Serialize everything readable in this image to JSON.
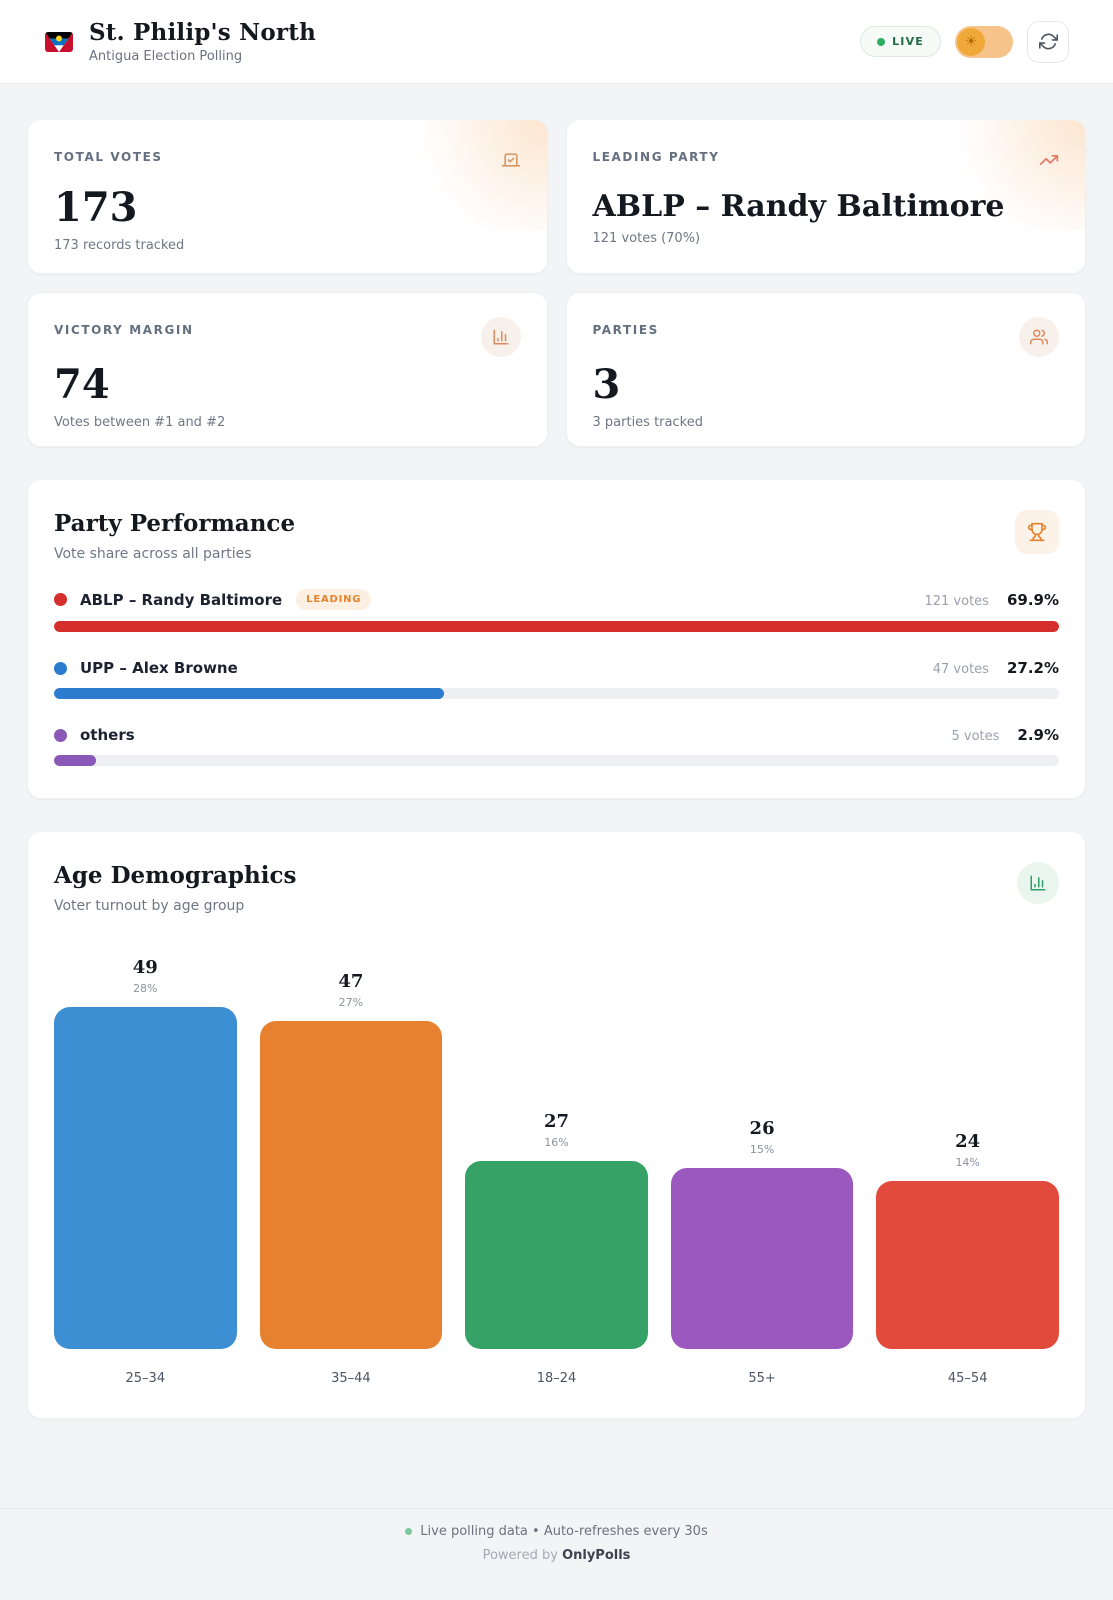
{
  "header": {
    "title": "St. Philip's North",
    "subtitle": "Antigua Election Polling",
    "live_label": "LIVE"
  },
  "colors": {
    "accent_orange": "#e5832e",
    "leading_red": "#d62e2c",
    "live_green": "#2eae63",
    "background": "#f3f4f6"
  },
  "stats": [
    {
      "label": "TOTAL VOTES",
      "value": "173",
      "subtitle": "173 records tracked",
      "icon": "ballot-box-icon"
    },
    {
      "label": "LEADING PARTY",
      "value": "ABLP – Randy Baltimore",
      "subtitle": "121 votes (70%)",
      "icon": "trending-up-icon"
    },
    {
      "label": "VICTORY MARGIN",
      "value": "74",
      "subtitle": "Votes between #1 and #2",
      "icon": "bar-chart-icon"
    },
    {
      "label": "PARTIES",
      "value": "3",
      "subtitle": "3 parties tracked",
      "icon": "users-icon"
    }
  ],
  "party_performance": {
    "title": "Party Performance",
    "subtitle": "Vote share across all parties",
    "icon": "trophy-icon",
    "rows": [
      {
        "name": "ABLP – Randy Baltimore",
        "badge": "LEADING",
        "votes": "121 votes",
        "percent": "69.9%"
      },
      {
        "name": "UPP – Alex Browne",
        "badge": "",
        "votes": "47 votes",
        "percent": "27.2%"
      },
      {
        "name": "others",
        "badge": "",
        "votes": "5 votes",
        "percent": "2.9%"
      }
    ]
  },
  "age_demographics": {
    "title": "Age Demographics",
    "subtitle": "Voter turnout by age group",
    "icon": "bar-chart-icon"
  },
  "chart_data": [
    {
      "type": "bar",
      "orientation": "horizontal",
      "title": "Party Performance",
      "subtitle": "Vote share across all parties",
      "categories": [
        "ABLP – Randy Baltimore",
        "UPP – Alex Browne",
        "others"
      ],
      "values": [
        121,
        47,
        5
      ],
      "percent_labels": [
        "69.9%",
        "27.2%",
        "2.9%"
      ],
      "colors": [
        "#d62e2c",
        "#2b7ccd",
        "#8a58b6"
      ],
      "note": "fill width normalized to leading party"
    },
    {
      "type": "bar",
      "orientation": "vertical",
      "title": "Age Demographics",
      "subtitle": "Voter turnout by age group",
      "categories": [
        "25–34",
        "35–44",
        "18–24",
        "55+",
        "45–54"
      ],
      "values": [
        49,
        47,
        27,
        26,
        24
      ],
      "percent_labels": [
        "28%",
        "27%",
        "16%",
        "15%",
        "14%"
      ],
      "colors": [
        "#3d8fd3",
        "#e8812f",
        "#36a266",
        "#9b59bf",
        "#e24a3c"
      ],
      "ylim": [
        0,
        49
      ]
    }
  ],
  "footer": {
    "status": "Live polling data • Auto-refreshes every 30s",
    "powered_prefix": "Powered by",
    "brand": "OnlyPolls"
  }
}
